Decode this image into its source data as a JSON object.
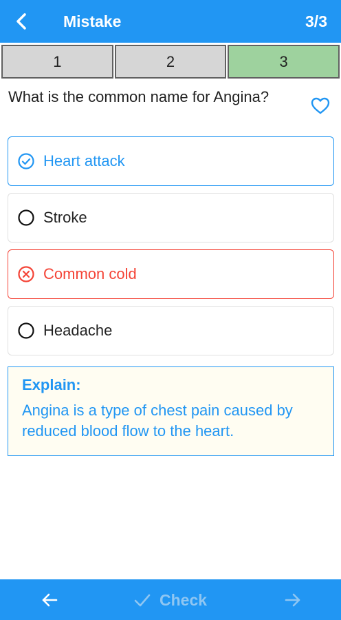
{
  "header": {
    "title": "Mistake",
    "count": "3/3",
    "back_icon": "chevron-left-icon"
  },
  "tabs": [
    {
      "label": "1",
      "active": false
    },
    {
      "label": "2",
      "active": false
    },
    {
      "label": "3",
      "active": true
    }
  ],
  "question": {
    "text": "What is the common name for Angina?",
    "favorite_icon": "heart-outline-icon"
  },
  "options": [
    {
      "label": "Heart attack",
      "state": "correct",
      "icon": "check-circle-icon"
    },
    {
      "label": "Stroke",
      "state": "neutral",
      "icon": "radio-empty-icon"
    },
    {
      "label": "Common cold",
      "state": "wrong",
      "icon": "x-circle-icon"
    },
    {
      "label": "Headache",
      "state": "neutral",
      "icon": "radio-empty-icon"
    }
  ],
  "explain": {
    "title": "Explain:",
    "text": "Angina is a type of chest pain caused by reduced blood flow to the heart."
  },
  "footer": {
    "prev_icon": "arrow-left-icon",
    "check_label": "Check",
    "check_icon": "check-icon",
    "next_icon": "arrow-right-icon"
  },
  "colors": {
    "primary": "#2196f3",
    "correct": "#2196f3",
    "wrong": "#f44336",
    "active_tab": "#9ed29e",
    "tab": "#d6d6d6",
    "explain_bg": "#fffdf2",
    "disabled_text": "#8fc6f2"
  }
}
